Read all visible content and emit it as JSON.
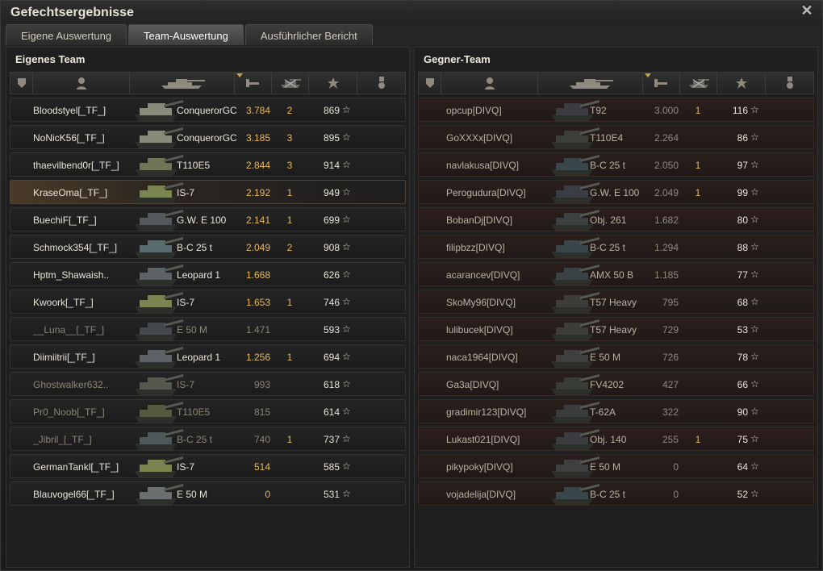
{
  "window": {
    "title": "Gefechtsergebnisse"
  },
  "tabs": [
    "Eigene Auswertung",
    "Team-Auswertung",
    "Ausführlicher Bericht"
  ],
  "active_tab": 1,
  "own_team": {
    "title": "Eigenes Team",
    "players": [
      {
        "name": "Bloodstyel[_TF_]",
        "vehicle": "ConquerorGC",
        "xp": "3.784",
        "kills": "2",
        "score": "869",
        "self": false,
        "dead": false
      },
      {
        "name": "NoNicK56[_TF_]",
        "vehicle": "ConquerorGC",
        "xp": "3.185",
        "kills": "3",
        "score": "895",
        "self": false,
        "dead": false
      },
      {
        "name": "thaevilbend0r[_TF_]",
        "vehicle": "T110E5",
        "xp": "2.844",
        "kills": "3",
        "score": "914",
        "self": false,
        "dead": false
      },
      {
        "name": "KraseOma[_TF_]",
        "vehicle": "IS-7",
        "xp": "2.192",
        "kills": "1",
        "score": "949",
        "self": true,
        "dead": false
      },
      {
        "name": "BuechiF[_TF_]",
        "vehicle": "G.W. E 100",
        "xp": "2.141",
        "kills": "1",
        "score": "699",
        "self": false,
        "dead": false
      },
      {
        "name": "Schmock354[_TF_]",
        "vehicle": "B-C 25 t",
        "xp": "2.049",
        "kills": "2",
        "score": "908",
        "self": false,
        "dead": false
      },
      {
        "name": "Hptm_Shawaish..",
        "vehicle": "Leopard 1",
        "xp": "1.668",
        "kills": "",
        "score": "626",
        "self": false,
        "dead": false
      },
      {
        "name": "Kwoork[_TF_]",
        "vehicle": "IS-7",
        "xp": "1.653",
        "kills": "1",
        "score": "746",
        "self": false,
        "dead": false
      },
      {
        "name": "__Luna__[_TF_]",
        "vehicle": "E 50 M",
        "xp": "1.471",
        "kills": "",
        "score": "593",
        "self": false,
        "dead": true
      },
      {
        "name": "Diimiitrii[_TF_]",
        "vehicle": "Leopard 1",
        "xp": "1.256",
        "kills": "1",
        "score": "694",
        "self": false,
        "dead": false
      },
      {
        "name": "Ghostwalker632..",
        "vehicle": "IS-7",
        "xp": "993",
        "kills": "",
        "score": "618",
        "self": false,
        "dead": true
      },
      {
        "name": "Pr0_Noob[_TF_]",
        "vehicle": "T110E5",
        "xp": "815",
        "kills": "",
        "score": "614",
        "self": false,
        "dead": true
      },
      {
        "name": "_Jibril_[_TF_]",
        "vehicle": "B-C 25 t",
        "xp": "740",
        "kills": "1",
        "score": "737",
        "self": false,
        "dead": true
      },
      {
        "name": "GermanTankl[_TF_]",
        "vehicle": "IS-7",
        "xp": "514",
        "kills": "",
        "score": "585",
        "self": false,
        "dead": false
      },
      {
        "name": "Blauvogel66[_TF_]",
        "vehicle": "E 50 M",
        "xp": "0",
        "kills": "",
        "score": "531",
        "self": false,
        "dead": false
      }
    ]
  },
  "enemy_team": {
    "title": "Gegner-Team",
    "players": [
      {
        "name": "opcup[DIVQ]",
        "vehicle": "T92",
        "xp": "3.000",
        "kills": "1",
        "score": "116"
      },
      {
        "name": "GoXXXx[DIVQ]",
        "vehicle": "T110E4",
        "xp": "2.264",
        "kills": "",
        "score": "86"
      },
      {
        "name": "navlakusa[DIVQ]",
        "vehicle": "B-C 25 t",
        "xp": "2.050",
        "kills": "1",
        "score": "97"
      },
      {
        "name": "Perogudura[DIVQ]",
        "vehicle": "G.W. E 100",
        "xp": "2.049",
        "kills": "1",
        "score": "99"
      },
      {
        "name": "BobanDj[DIVQ]",
        "vehicle": "Obj. 261",
        "xp": "1.682",
        "kills": "",
        "score": "80"
      },
      {
        "name": "filipbzz[DIVQ]",
        "vehicle": "B-C 25 t",
        "xp": "1.294",
        "kills": "",
        "score": "88"
      },
      {
        "name": "acarancev[DIVQ]",
        "vehicle": "AMX 50 B",
        "xp": "1.185",
        "kills": "",
        "score": "77"
      },
      {
        "name": "SkoMy96[DIVQ]",
        "vehicle": "T57 Heavy",
        "xp": "795",
        "kills": "",
        "score": "68"
      },
      {
        "name": "lulibucek[DIVQ]",
        "vehicle": "T57 Heavy",
        "xp": "729",
        "kills": "",
        "score": "53"
      },
      {
        "name": "naca1964[DIVQ]",
        "vehicle": "E 50 M",
        "xp": "726",
        "kills": "",
        "score": "78"
      },
      {
        "name": "Ga3a[DIVQ]",
        "vehicle": "FV4202",
        "xp": "427",
        "kills": "",
        "score": "66"
      },
      {
        "name": "gradimir123[DIVQ]",
        "vehicle": "T-62A",
        "xp": "322",
        "kills": "",
        "score": "90"
      },
      {
        "name": "Lukast021[DIVQ]",
        "vehicle": "Obj. 140",
        "xp": "255",
        "kills": "1",
        "score": "75"
      },
      {
        "name": "pikypoky[DIVQ]",
        "vehicle": "E 50 M",
        "xp": "0",
        "kills": "",
        "score": "64"
      },
      {
        "name": "vojadelija[DIVQ]",
        "vehicle": "B-C 25 t",
        "xp": "0",
        "kills": "",
        "score": "52"
      }
    ]
  },
  "columns": [
    "squad-icon",
    "player-icon",
    "tank-icon",
    "xp-icon",
    "kills-icon",
    "star-icon",
    "medal-icon"
  ],
  "star_glyph": "☆",
  "colors": {
    "accent": "#e7b95a",
    "enemy_row": "#2b1f1c",
    "self_row": "#4a3a28"
  }
}
